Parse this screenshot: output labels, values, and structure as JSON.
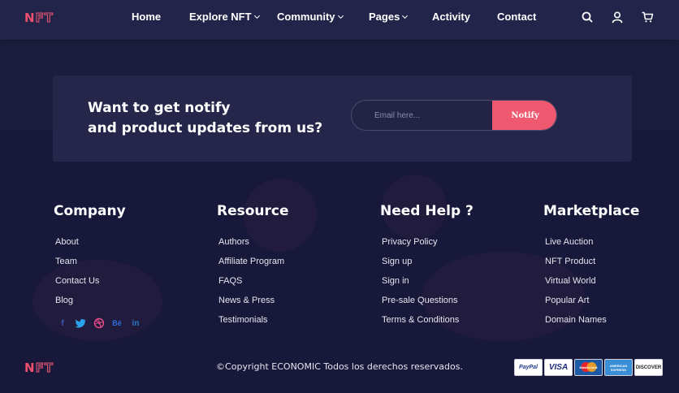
{
  "brand": {
    "logo_text": "NFT",
    "accent_color": "#f0506e"
  },
  "nav": {
    "items": [
      {
        "label": "Home",
        "has_caret": false
      },
      {
        "label": "Explore NFT",
        "has_caret": true
      },
      {
        "label": "Community",
        "has_caret": true
      },
      {
        "label": "Pages",
        "has_caret": true
      },
      {
        "label": "Activity",
        "has_caret": false
      },
      {
        "label": "Contact",
        "has_caret": false
      }
    ],
    "icons": [
      "search-icon",
      "user-icon",
      "cart-icon"
    ]
  },
  "newsletter": {
    "title_line1": "Want to get notify",
    "title_line2": "and product updates from us?",
    "email_placeholder": "Email here...",
    "button_label": "Notify",
    "button_color": "#f0586f"
  },
  "footer": {
    "columns": [
      {
        "title": "Company",
        "links": [
          "About",
          "Team",
          "Contact Us",
          "Blog"
        ]
      },
      {
        "title": "Resource",
        "links": [
          "Authors",
          "Affiliate Program",
          "FAQS",
          "News & Press",
          "Testimonials"
        ]
      },
      {
        "title": "Need Help ?",
        "links": [
          "Privacy Policy",
          "Sign up",
          "Sign in",
          "Pre-sale Questions",
          "Terms & Conditions"
        ]
      },
      {
        "title": "Marketplace",
        "links": [
          "Live Auction",
          "NFT Product",
          "Virtual World",
          "Popular Art",
          "Domain Names"
        ]
      }
    ],
    "social": [
      {
        "name": "facebook-icon",
        "glyph": "f"
      },
      {
        "name": "twitter-icon",
        "glyph": ""
      },
      {
        "name": "dribbble-icon",
        "glyph": ""
      },
      {
        "name": "behance-icon",
        "glyph": "Bē"
      },
      {
        "name": "linkedin-icon",
        "glyph": "in"
      }
    ],
    "copyright": "©Copyright ECONOMIC Todos los derechos reservados.",
    "payment_cards": [
      {
        "name": "paypal-card",
        "label": "PayPal"
      },
      {
        "name": "visa-card",
        "label": "VISA"
      },
      {
        "name": "mastercard-card",
        "label": "MasterCard"
      },
      {
        "name": "amex-card",
        "label": "AMERICAN EXPRESS"
      },
      {
        "name": "discover-card",
        "label": "DISCOVER"
      }
    ]
  }
}
